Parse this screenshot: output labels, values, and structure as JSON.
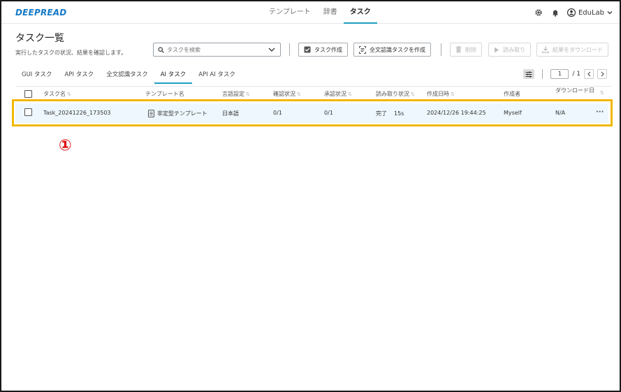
{
  "app": {
    "logo": "DEEPREAD",
    "nav_tabs": [
      {
        "label": "テンプレート",
        "active": false
      },
      {
        "label": "辞書",
        "active": false
      },
      {
        "label": "タスク",
        "active": true
      }
    ],
    "user": "EduLab",
    "icons": [
      "gear-icon",
      "bell-icon",
      "user-icon",
      "chevron-down-icon"
    ]
  },
  "header": {
    "title": "タスク一覧",
    "subtitle": "実行したタスクの状況、結果を確認します。"
  },
  "toolbar": {
    "search_placeholder": "タスクを検索",
    "create_task": "タスク作成",
    "create_fulltext_task": "全文認識タスクを作成",
    "delete": "削除",
    "read": "読み取り",
    "download_results": "結果をダウンロード"
  },
  "subtabs": [
    {
      "label": "GUI タスク",
      "active": false
    },
    {
      "label": "API タスク",
      "active": false
    },
    {
      "label": "全文認識タスク",
      "active": false
    },
    {
      "label": "AI タスク",
      "active": true
    },
    {
      "label": "API AI タスク",
      "active": false
    }
  ],
  "pager": {
    "current": "1",
    "total": "/ 1"
  },
  "table": {
    "columns": [
      "タスク名",
      "テンプレート名",
      "言語設定",
      "確認状況",
      "承認状況",
      "読み取り状況",
      "作成日時",
      "作成者",
      "ダウンロード日時"
    ],
    "rows": [
      {
        "task_name": "Task_20241226_173503",
        "template": "非定型テンプレート",
        "language": "日本語",
        "confirm": "0/1",
        "approve": "0/1",
        "read_status": "完了",
        "read_time": "15s",
        "created": "2024/12/26 19:44:25",
        "creator": "Myself",
        "downloaded": "N/A",
        "more": "···"
      }
    ]
  },
  "annotation": {
    "label": "①",
    "color": "#e00000",
    "highlight_color": "#f2b800"
  },
  "colors": {
    "accent": "#1f9fc4",
    "logo": "#1479c7",
    "row_bg": "#eef7fd"
  }
}
